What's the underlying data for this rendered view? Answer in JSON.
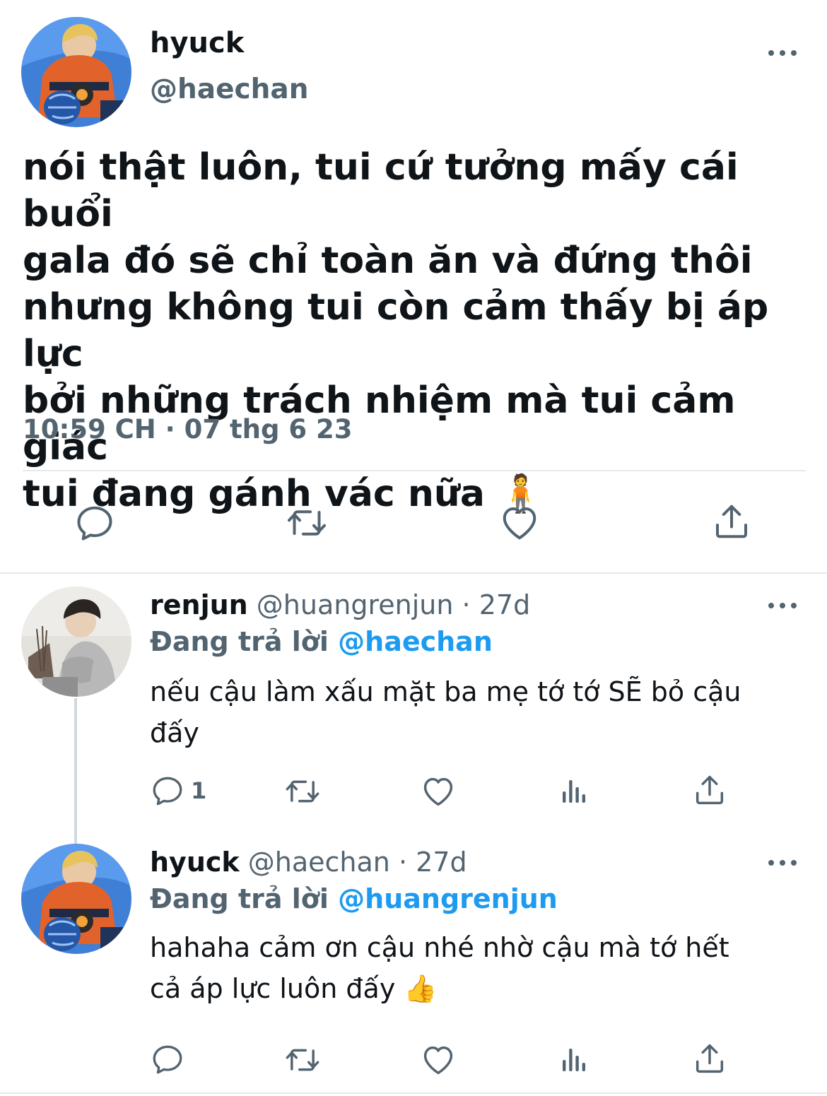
{
  "main_tweet": {
    "display_name": "hyuck",
    "handle": "@haechan",
    "text": "nói thật luôn, tui cứ tưởng mấy cái buổi\ngala đó sẽ chỉ toàn ăn và đứng thôi\nnhưng không tui còn cảm thấy bị áp lực\nbởi những trách nhiệm mà tui cảm giác\ntui đang gánh vác nữa 🧍",
    "timestamp": "10:59 CH · 07 thg 6 23"
  },
  "replies": [
    {
      "display_name": "renjun",
      "handle": "@huangrenjun",
      "age": "27d",
      "replying_prefix": "Đang trả lời",
      "replying_to": "@haechan",
      "text": "nếu cậu làm xấu mặt ba mẹ tớ tớ SẼ bỏ cậu\nđấy",
      "reply_count": "1"
    },
    {
      "display_name": "hyuck",
      "handle": "@haechan",
      "age": "27d",
      "replying_prefix": "Đang trả lời",
      "replying_to": "@huangrenjun",
      "text": "hahaha cảm ơn cậu nhé nhờ cậu mà tớ hết\ncả áp lực luôn đấy 👍",
      "reply_count": ""
    }
  ],
  "icons": {
    "reply": "reply-icon",
    "retweet": "retweet-icon",
    "like": "heart-icon",
    "views": "analytics-icon",
    "share": "share-icon",
    "more": "more-icon"
  },
  "colors": {
    "text": "#0f1419",
    "secondary": "#536471",
    "accent": "#1d9bf0",
    "divider": "#e6e9ec"
  }
}
